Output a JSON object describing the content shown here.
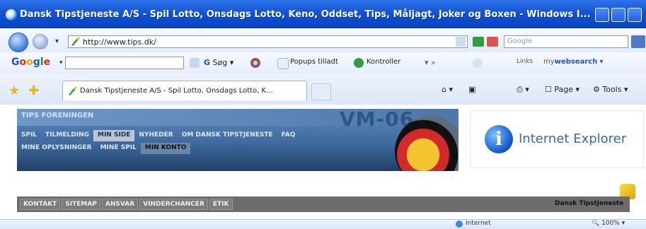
{
  "window": {
    "title": "Dansk Tipstjeneste A/S - Spil Lotto, Onsdags Lotto, Keno, Oddset, Tips, Måljagt, Joker og Boxen - Windows I..."
  },
  "address_bar": {
    "url": "http://www.tips.dk/",
    "search_placeholder": "Google"
  },
  "google_toolbar": {
    "logo_letters": [
      "G",
      "o",
      "o",
      "g",
      "l",
      "e"
    ],
    "search_label": "Søg",
    "popup_label": "Popups tilladt",
    "check_label": "Kontroller",
    "links_label": "Links",
    "websearch_prefix": "my",
    "websearch_brand": "websearch"
  },
  "tabs": {
    "active_tab_title": "Dansk Tipstjeneste A/S - Spil Lotto, Onsdags Lotto, K...",
    "page_label": "Page",
    "tools_label": "Tools"
  },
  "banner": {
    "brand": "TIPS FORENINGEN",
    "vm_title": "VM-06",
    "nav_primary": [
      "SPIL",
      "TILMELDING",
      "MIN SIDE",
      "NYHEDER",
      "OM DANSK TIPSTJENESTE",
      "FAQ"
    ],
    "nav_secondary": [
      "MINE OPLYSNINGER",
      "MINE SPIL",
      "MIN KONTO"
    ]
  },
  "ie_box": {
    "text": "Internet Explorer"
  },
  "footer": {
    "links": [
      "KONTAKT",
      "SITEMAP",
      "ANSVAR",
      "VINDERCHANCER",
      "ETIK"
    ],
    "right_text": "Dansk Tipstjeneste"
  },
  "status_bar": {
    "zone": "Internet",
    "zoom": "100%"
  }
}
